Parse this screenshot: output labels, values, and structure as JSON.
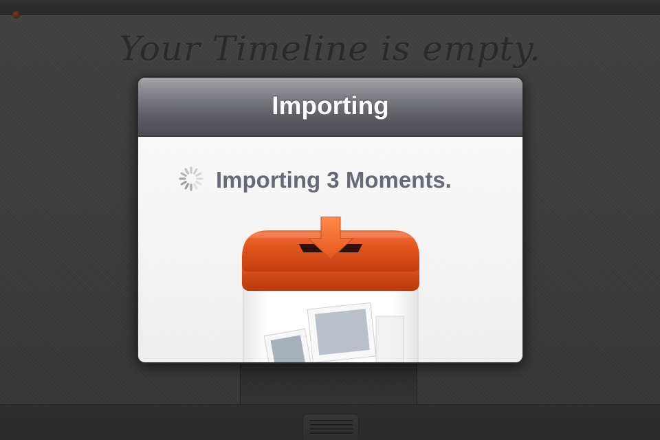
{
  "background": {
    "empty_message": "Your Timeline is empty."
  },
  "dialog": {
    "title": "Importing",
    "status_text": "Importing 3 Moments.",
    "spinner_icon": "activity-spinner-icon",
    "illustration_icon": "import-box-icon",
    "accent_color": "#e8581c"
  },
  "toolbar": {
    "grip_icon": "grip-lines-icon"
  }
}
